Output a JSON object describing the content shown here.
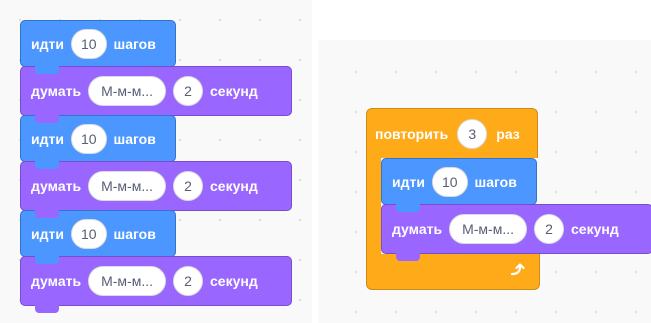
{
  "left_stack": [
    {
      "kind": "motion",
      "pre": "идти",
      "value": "10",
      "post": "шагов"
    },
    {
      "kind": "looks",
      "pre": "думать",
      "text": "М-м-м...",
      "value": "2",
      "post": "секунд"
    },
    {
      "kind": "motion",
      "pre": "идти",
      "value": "10",
      "post": "шагов"
    },
    {
      "kind": "looks",
      "pre": "думать",
      "text": "М-м-м...",
      "value": "2",
      "post": "секунд"
    },
    {
      "kind": "motion",
      "pre": "идти",
      "value": "10",
      "post": "шагов"
    },
    {
      "kind": "looks",
      "pre": "думать",
      "text": "М-м-м...",
      "value": "2",
      "post": "секунд"
    }
  ],
  "repeat_block": {
    "pre": "повторить",
    "value": "3",
    "post": "раз",
    "icon": "loop-arrow-icon",
    "inner": [
      {
        "kind": "motion",
        "pre": "идти",
        "value": "10",
        "post": "шагов"
      },
      {
        "kind": "looks",
        "pre": "думать",
        "text": "М-м-м...",
        "value": "2",
        "post": "секунд"
      }
    ]
  },
  "colors": {
    "motion": "#4c97ff",
    "looks": "#9966ff",
    "control": "#ffab19",
    "workspace": "#f9f9f9"
  }
}
